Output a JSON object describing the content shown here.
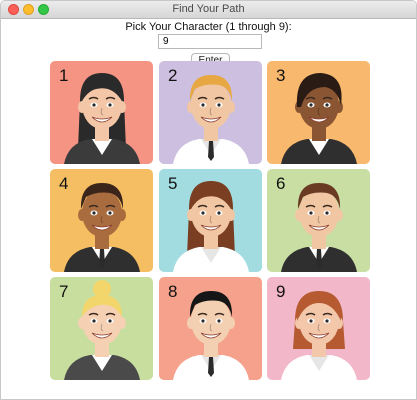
{
  "window": {
    "title": "Find Your Path"
  },
  "form": {
    "prompt": "Pick Your Character (1 through 9):",
    "input_value": "9",
    "button_label": "Enter"
  },
  "colors": {
    "accent": "#333333"
  },
  "characters": [
    {
      "number": "1",
      "bg": "#f59483",
      "skin": "#f2c6a6",
      "hair": "#2a2a2a",
      "hair_style": "long",
      "outfit": "#3b3b3b",
      "gender": "female"
    },
    {
      "number": "2",
      "bg": "#cdbfe0",
      "skin": "#f1c6a3",
      "hair": "#e7a844",
      "hair_style": "short",
      "outfit": "#ffffff",
      "gender": "male"
    },
    {
      "number": "3",
      "bg": "#f8b86d",
      "skin": "#8a5532",
      "hair": "#2a1c14",
      "hair_style": "short-bob",
      "outfit": "#2f2f2f",
      "gender": "female"
    },
    {
      "number": "4",
      "bg": "#f5be62",
      "skin": "#a86c3f",
      "hair": "#3b241a",
      "hair_style": "short",
      "outfit": "#2f2f2f",
      "gender": "male"
    },
    {
      "number": "5",
      "bg": "#a2dbe0",
      "skin": "#f1c6a3",
      "hair": "#7a3e22",
      "hair_style": "long",
      "outfit": "#ffffff",
      "gender": "female"
    },
    {
      "number": "6",
      "bg": "#c8dea2",
      "skin": "#f1c6a3",
      "hair": "#6a3a22",
      "hair_style": "short",
      "outfit": "#2f2f2f",
      "gender": "male"
    },
    {
      "number": "7",
      "bg": "#c7de9e",
      "skin": "#f6d0b3",
      "hair": "#f3d66b",
      "hair_style": "bun",
      "outfit": "#4a4a4a",
      "gender": "female"
    },
    {
      "number": "8",
      "bg": "#f5a18b",
      "skin": "#f4d0b2",
      "hair": "#161616",
      "hair_style": "short",
      "outfit": "#ffffff",
      "gender": "male"
    },
    {
      "number": "9",
      "bg": "#f2b7c8",
      "skin": "#f3c8aa",
      "hair": "#b65a32",
      "hair_style": "bob",
      "outfit": "#ffffff",
      "gender": "female"
    }
  ]
}
